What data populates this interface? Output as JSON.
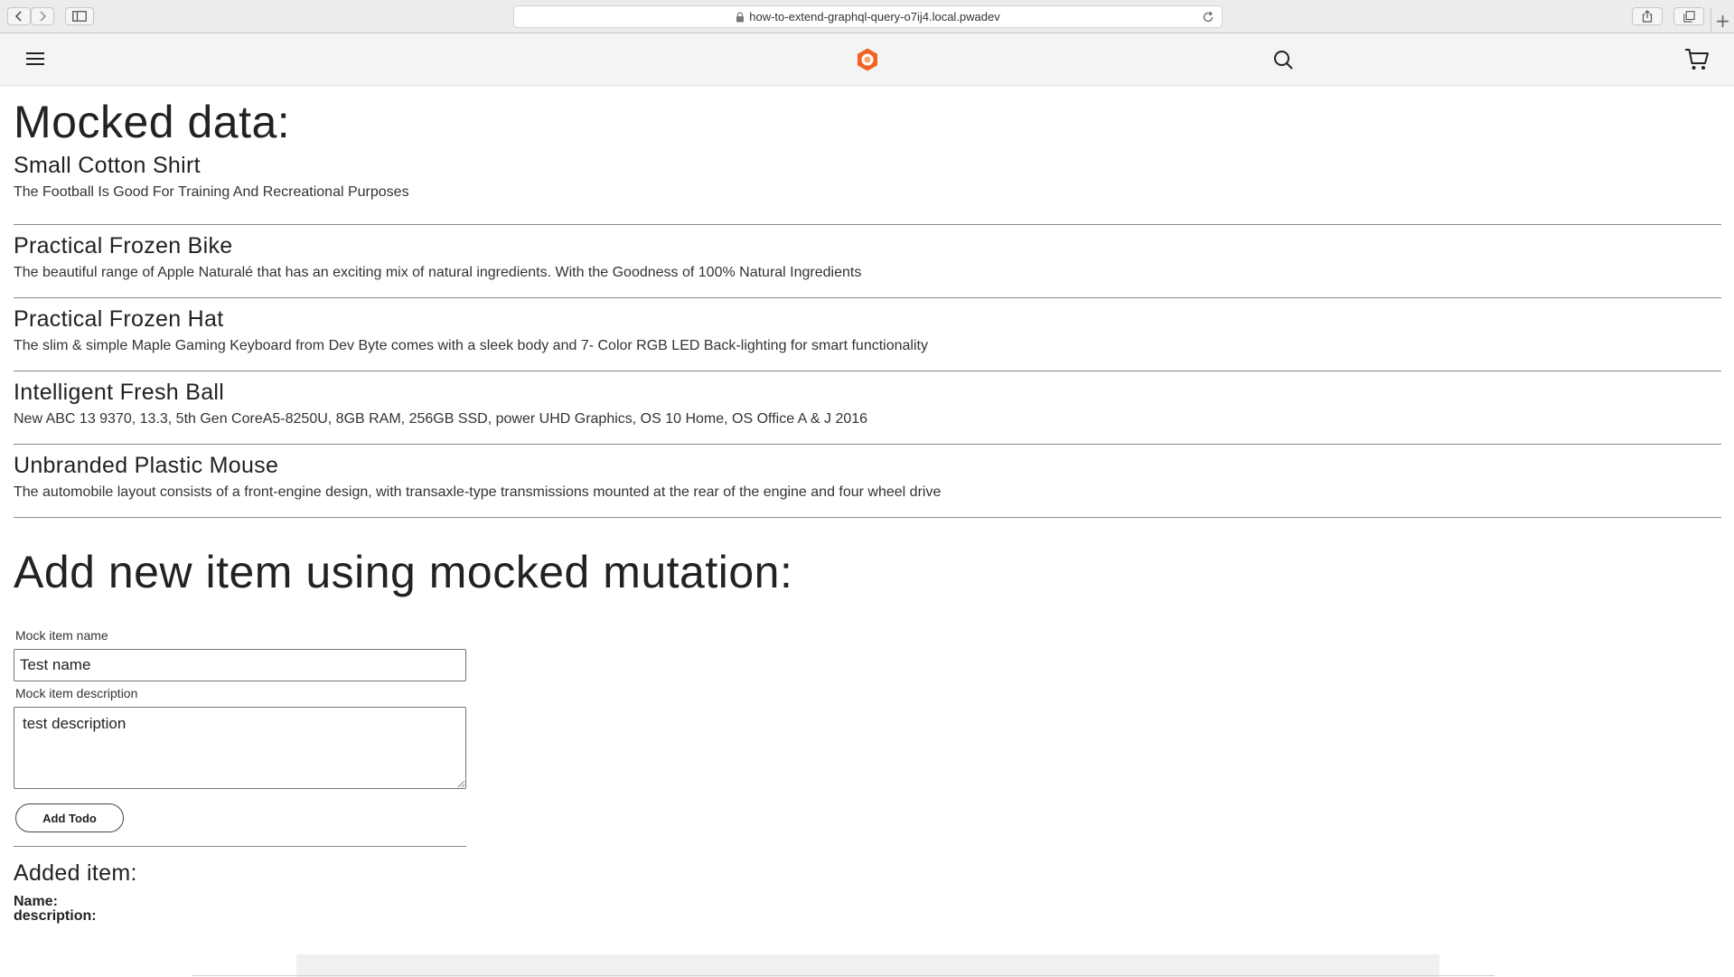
{
  "browser": {
    "url": "how-to-extend-graphql-query-o7ij4.local.pwadev",
    "new_tab_label": "+"
  },
  "header": {
    "menu_icon": "hamburger-menu-icon",
    "logo_icon": "brand-logo-icon",
    "search_icon": "search-icon",
    "cart_icon": "shopping-cart-icon",
    "brand_color": "#F26322"
  },
  "mocked": {
    "title": "Mocked data:",
    "items": [
      {
        "name": "Small Cotton Shirt",
        "description": "The Football Is Good For Training And Recreational Purposes"
      },
      {
        "name": "Practical Frozen Bike",
        "description": "The beautiful range of Apple Naturalé that has an exciting mix of natural ingredients. With the Goodness of 100% Natural Ingredients"
      },
      {
        "name": "Practical Frozen Hat",
        "description": "The slim & simple Maple Gaming Keyboard from Dev Byte comes with a sleek body and 7- Color RGB LED Back-lighting for smart functionality"
      },
      {
        "name": "Intelligent Fresh Ball",
        "description": "New ABC 13 9370, 13.3, 5th Gen CoreA5-8250U, 8GB RAM, 256GB SSD, power UHD Graphics, OS 10 Home, OS Office A & J 2016"
      },
      {
        "name": "Unbranded Plastic Mouse",
        "description": "The automobile layout consists of a front-engine design, with transaxle-type transmissions mounted at the rear of the engine and four wheel drive"
      }
    ]
  },
  "mutation": {
    "title": "Add new item using mocked mutation:",
    "name_label": "Mock item name",
    "name_value": "Test name",
    "description_label": "Mock item description",
    "description_value": "test description",
    "submit_label": "Add Todo"
  },
  "added": {
    "title": "Added item:",
    "name_label": "Name:",
    "description_label": "description:"
  }
}
